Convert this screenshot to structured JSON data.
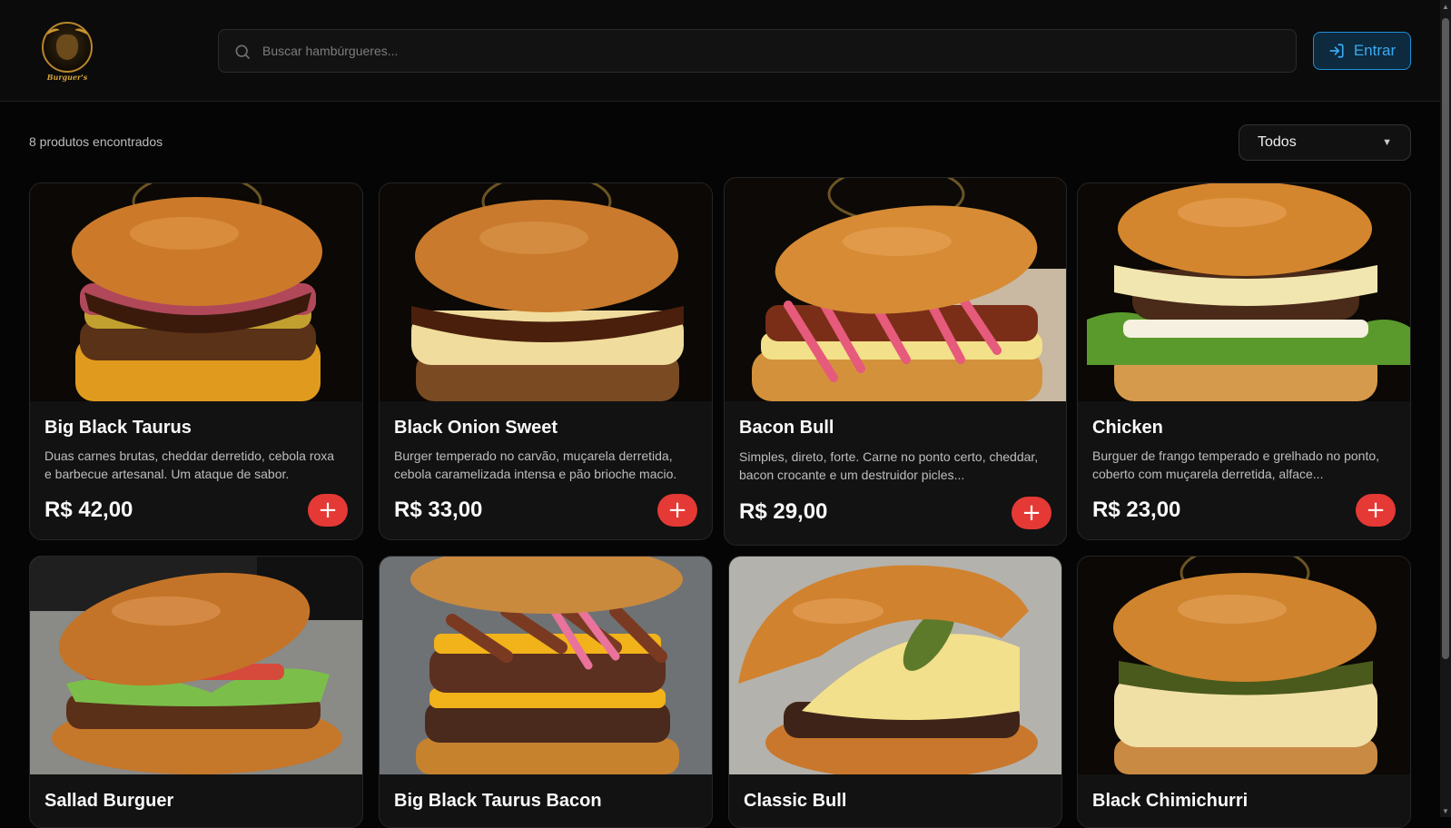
{
  "header": {
    "logo_text": "Burguer's",
    "search_placeholder": "Buscar hambúrgueres...",
    "login_label": "Entrar"
  },
  "toolbar": {
    "results_count": "8 produtos encontrados",
    "filter_selected": "Todos"
  },
  "products": [
    {
      "name": "Big Black Taurus",
      "description": "Duas carnes brutas, cheddar derretido, cebola roxa e barbecue artesanal. Um ataque de sabor.",
      "price": "R$ 42,00"
    },
    {
      "name": "Black Onion Sweet",
      "description": "Burger temperado no carvão, muçarela derretida, cebola caramelizada intensa e pão brioche macio.",
      "price": "R$ 33,00"
    },
    {
      "name": "Bacon Bull",
      "description": "Simples, direto, forte. Carne no ponto certo, cheddar, bacon crocante e um destruidor picles...",
      "price": "R$ 29,00"
    },
    {
      "name": "Chicken",
      "description": "Burguer de frango temperado e grelhado no ponto, coberto com muçarela derretida, alface...",
      "price": "R$ 23,00"
    },
    {
      "name": "Sallad Burguer",
      "description": "",
      "price": ""
    },
    {
      "name": "Big Black Taurus Bacon",
      "description": "",
      "price": ""
    },
    {
      "name": "Classic Bull",
      "description": "",
      "price": ""
    },
    {
      "name": "Black Chimichurri",
      "description": "",
      "price": ""
    }
  ],
  "colors": {
    "accent": "#e53935",
    "login_blue": "#1f8fd6",
    "background": "#050505",
    "card": "#121212"
  }
}
